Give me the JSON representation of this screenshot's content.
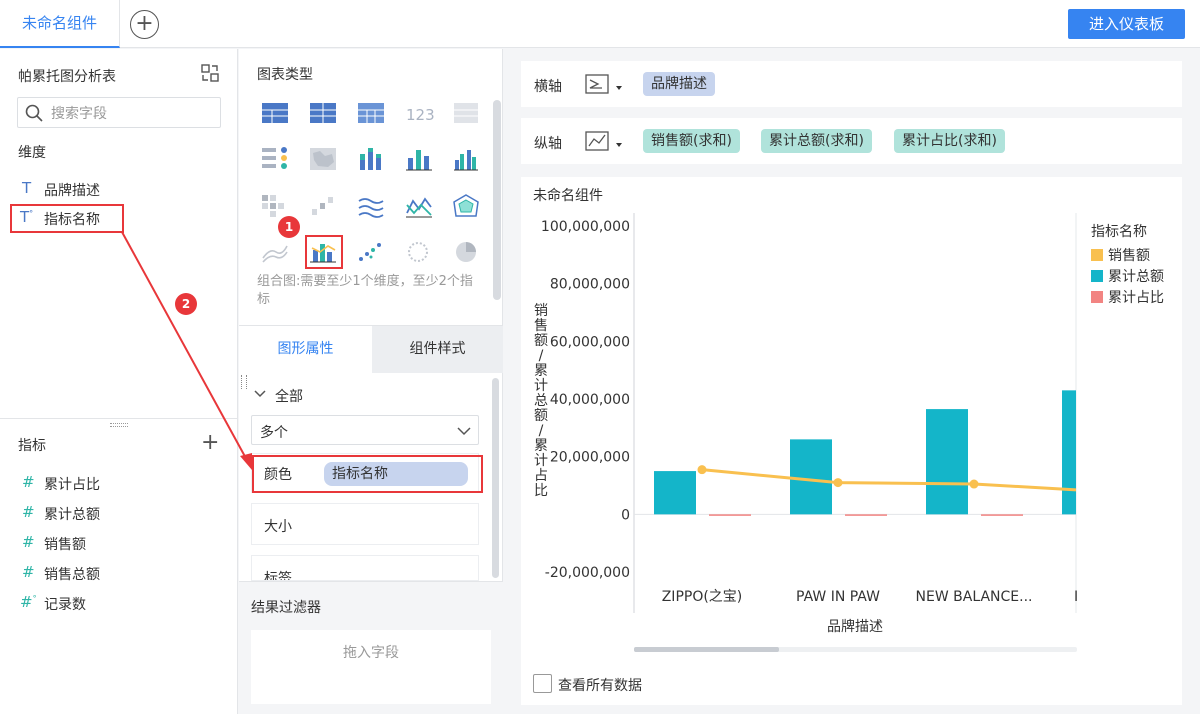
{
  "topbar": {
    "tab_label": "未命名组件",
    "add_tab": "+",
    "enter_button": "进入仪表板"
  },
  "left": {
    "title": "帕累托图分析表",
    "search_placeholder": "搜索字段",
    "dimension_header": "维度",
    "dimensions": [
      "品牌描述",
      "指标名称"
    ],
    "measure_header": "指标",
    "measures": [
      "累计占比",
      "累计总额",
      "销售额",
      "销售总额",
      "记录数"
    ]
  },
  "middle": {
    "chart_types_title": "图表类型",
    "tooltip": "组合图:需要至少1个维度，至少2个指标",
    "tab_graph_props": "图形属性",
    "tab_component_style": "组件样式",
    "all_label": "全部",
    "select_value": "多个",
    "color_label": "颜色",
    "color_pill": "指标名称",
    "size_label": "大小",
    "label_label": "标签",
    "result_filter": "结果过滤器",
    "drop_field": "拖入字段"
  },
  "axes": {
    "x_label": "横轴",
    "x_pills": [
      "品牌描述"
    ],
    "y_label": "纵轴",
    "y_pills": [
      "销售额(求和)",
      "累计总额(求和)",
      "累计占比(求和)"
    ]
  },
  "chart_card": {
    "title": "未命名组件",
    "view_all": "查看所有数据"
  },
  "annotations": {
    "badge1": "1",
    "badge2": "2"
  },
  "chart_data": {
    "type": "bar",
    "categories": [
      "ZIPPO(之宝)",
      "PAW IN PAW",
      "NEW BALANCE...",
      "I"
    ],
    "series": [
      {
        "name": "销售额",
        "kind": "line",
        "color": "#f9c04f",
        "values": [
          15500000,
          11000000,
          10500000,
          8500000
        ]
      },
      {
        "name": "累计总额",
        "kind": "bar",
        "color": "#14b5c9",
        "values": [
          15000000,
          26000000,
          36500000,
          43000000
        ]
      },
      {
        "name": "累计占比",
        "kind": "bar",
        "color": "#f28482",
        "values": [
          0.5,
          0.7,
          0.8,
          0.9
        ]
      }
    ],
    "ylim": [
      -20000000,
      100000000
    ],
    "yticks": [
      "100,000,000",
      "80,000,000",
      "60,000,000",
      "40,000,000",
      "20,000,000",
      "0",
      "-20,000,000"
    ],
    "ytick_values": [
      100000000,
      80000000,
      60000000,
      40000000,
      20000000,
      0,
      -20000000
    ],
    "xlabel": "品牌描述",
    "ylabel": "销售额/累计总额/累计占比",
    "legend_title": "指标名称",
    "legend_position": "right"
  }
}
